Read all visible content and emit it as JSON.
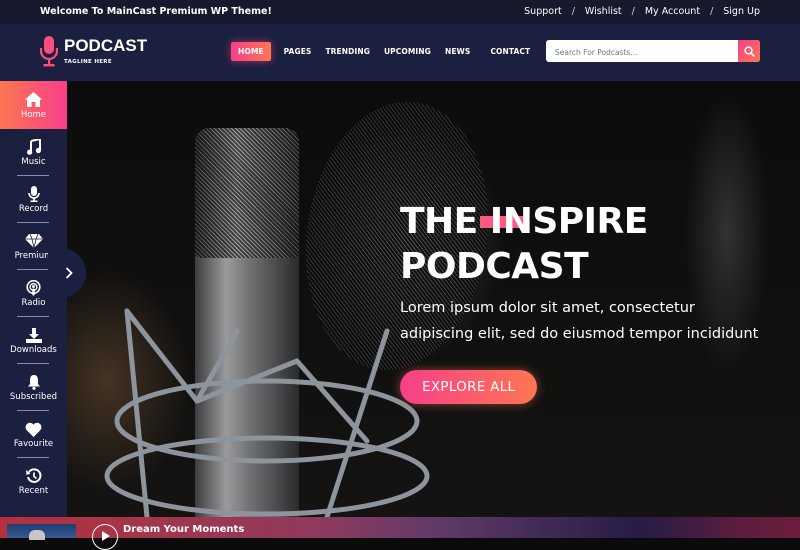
{
  "topbar": {
    "welcome": "Welcome To MainCast Premium WP Theme!",
    "links": [
      "Support",
      "Wishlist",
      "My Account",
      "Sign Up"
    ],
    "separator": "/"
  },
  "header": {
    "logo_title": "PODCAST",
    "logo_tagline": "TAGLINE HERE",
    "nav": [
      {
        "label": "HOME",
        "active": true
      },
      {
        "label": "PAGES",
        "active": false
      },
      {
        "label": "TRENDING",
        "active": false
      },
      {
        "label": "UPCOMING",
        "active": false
      },
      {
        "label": "NEWS",
        "active": false
      },
      {
        "label": "CONTACT",
        "active": false
      }
    ],
    "search": {
      "placeholder": "Search For Podcasts...",
      "value": "",
      "icon": "search-icon"
    }
  },
  "sidebar": {
    "items": [
      {
        "label": "Home",
        "icon": "home-icon",
        "active": true
      },
      {
        "label": "Music",
        "icon": "music-note-icon",
        "active": false
      },
      {
        "label": "Record",
        "icon": "microphone-icon",
        "active": false
      },
      {
        "label": "Premium",
        "icon": "diamond-icon",
        "active": false
      },
      {
        "label": "Radio",
        "icon": "podcast-icon",
        "active": false
      },
      {
        "label": "Downloads",
        "icon": "download-icon",
        "active": false
      },
      {
        "label": "Subscribed",
        "icon": "bell-icon",
        "active": false
      },
      {
        "label": "Favourite",
        "icon": "heart-icon",
        "active": false
      },
      {
        "label": "Recent",
        "icon": "history-icon",
        "active": false
      }
    ],
    "toggle_icon": "chevron-right-icon"
  },
  "hero": {
    "title_line1": "THE INSPIRE",
    "title_line2": "PODCAST",
    "subtitle_line1": "Lorem ipsum dolor sit amet, consectetur",
    "subtitle_line2": "adipiscing elit, sed do eiusmod tempor incididunt",
    "cta": "EXPLORE ALL"
  },
  "player": {
    "track_title": "Dream Your Moments"
  },
  "colors": {
    "accent_pink": "#f83f8a",
    "accent_orange": "#fd7651",
    "navy": "#1c2040",
    "topbar": "#161a2c"
  }
}
